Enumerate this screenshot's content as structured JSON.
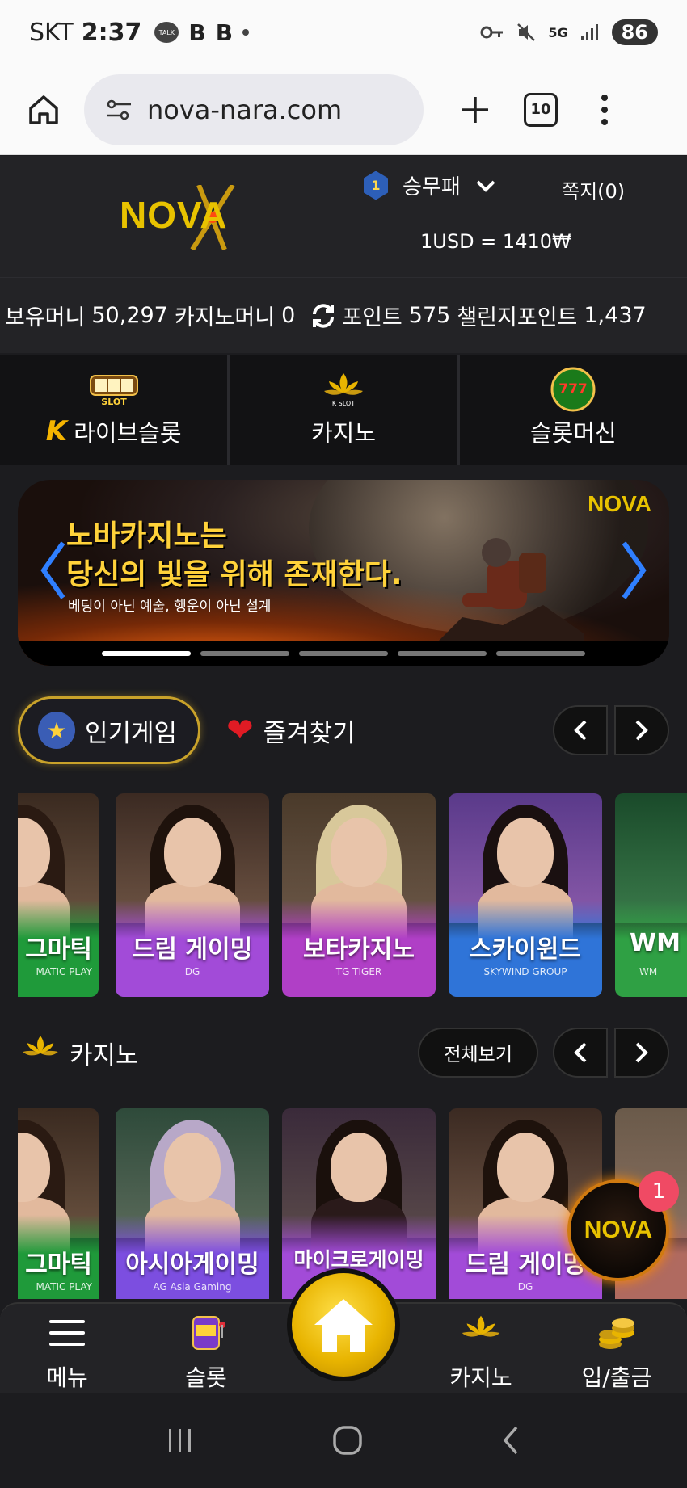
{
  "status_bar": {
    "carrier": "SKT",
    "time": "2:37",
    "bubble_label": "TALK",
    "notif_b1": "B",
    "notif_b2": "B",
    "network": "5G",
    "battery": "86"
  },
  "browser": {
    "url": "nova-nara.com",
    "tab_count": "10"
  },
  "header": {
    "logo": "NOVA",
    "rank_level": "1",
    "username": "승무패",
    "messages": "쪽지(0)",
    "exchange_rate": "1USD = 1410₩"
  },
  "balance": {
    "holding_label": "보유머니",
    "holding_value": "50,297",
    "casino_label": "카지노머니",
    "casino_value": "0",
    "point_label": "포인트",
    "point_value": "575",
    "challenge_label": "챌린지포인트",
    "challenge_value": "1,437"
  },
  "categories": [
    {
      "label": "라이브슬롯",
      "icon_text": "SLOT"
    },
    {
      "label": "카지노",
      "icon_text": "K SLOT"
    },
    {
      "label": "슬롯머신",
      "icon_text": "777"
    }
  ],
  "banner": {
    "headline1": "노바카지노는",
    "headline2": "당신의 빛을 위해 존재한다.",
    "subline": "베팅이 아닌 예술, 행운이 아닌 설계",
    "logo": "NOVA",
    "slide_count": 5,
    "active_slide": 1
  },
  "popular_section": {
    "tab_popular": "인기게임",
    "tab_favorites": "즐겨찾기"
  },
  "popular_games": [
    {
      "name": "그마틱",
      "provider": "MATIC PLAY",
      "bg": "#1f9a3a"
    },
    {
      "name": "드림 게이밍",
      "provider": "DG",
      "bg": "#a24bd8"
    },
    {
      "name": "보타카지노",
      "provider": "TG TIGER",
      "bg": "#b03fc6"
    },
    {
      "name": "스카이윈드",
      "provider": "SKYWIND GROUP",
      "bg": "#2f74d8"
    },
    {
      "name": "WM",
      "provider": "WM",
      "bg": "#2fa044"
    }
  ],
  "casino_section": {
    "title": "카지노",
    "view_all": "전체보기"
  },
  "casino_games": [
    {
      "name": "그마틱",
      "provider": "MATIC PLAY",
      "bg": "#1f9a3a"
    },
    {
      "name": "아시아게이밍",
      "provider": "AG Asia Gaming",
      "bg": "#7c4ee0"
    },
    {
      "name": "마이크로게이밍",
      "provider": "",
      "bg": "#a24bd8"
    },
    {
      "name": "드림 게이밍",
      "provider": "DG",
      "bg": "#a24bd8"
    },
    {
      "name": "",
      "provider": "",
      "bg": "#b06a60"
    }
  ],
  "float_button": {
    "label": "NOVA",
    "badge": "1"
  },
  "bottom_nav": {
    "menu": "메뉴",
    "slot": "슬롯",
    "casino": "카지노",
    "deposit": "입/출금"
  },
  "colors": {
    "accent_gold": "#e8c200",
    "page_bg": "#1c1c1f",
    "badge_pink": "#f04a64"
  }
}
